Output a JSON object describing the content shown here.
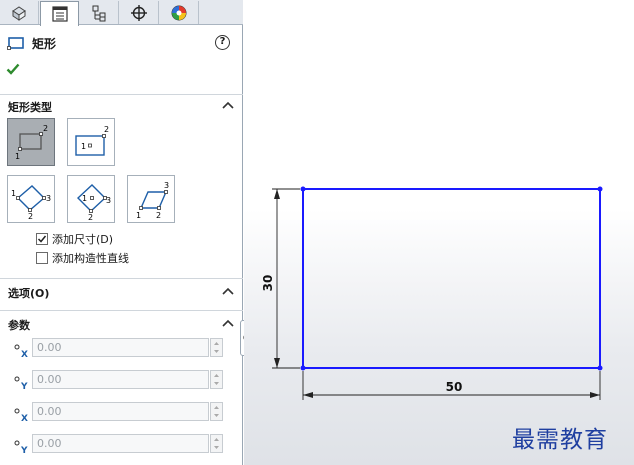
{
  "tabs": [
    {
      "name": "featuremanager-tab",
      "icon": "feature-tree-icon"
    },
    {
      "name": "propertymanager-tab",
      "icon": "property-manager-icon",
      "active": true
    },
    {
      "name": "configurationmanager-tab",
      "icon": "configuration-icon"
    },
    {
      "name": "dimxpertmanager-tab",
      "icon": "crosshair-icon"
    },
    {
      "name": "displaymanager-tab",
      "icon": "appearance-icon"
    }
  ],
  "property_manager": {
    "title": "矩形",
    "help_symbol": "?",
    "rectangle_type": {
      "title": "矩形类型",
      "options": [
        {
          "name": "corner-rectangle",
          "selected": true
        },
        {
          "name": "center-rectangle",
          "selected": false
        },
        {
          "name": "3-point-corner-rectangle",
          "selected": false
        },
        {
          "name": "3-point-center-rectangle",
          "selected": false
        },
        {
          "name": "parallelogram",
          "selected": false
        }
      ],
      "add_dimensions_label": "添加尺寸(D)",
      "add_dimensions_checked": true,
      "add_construction_label": "添加构造性直线",
      "add_construction_checked": false
    },
    "options_section": {
      "title": "选项(O)"
    },
    "parameters": {
      "title": "参数",
      "rows": [
        {
          "axis": "X",
          "value": "0.00"
        },
        {
          "axis": "Y",
          "value": "0.00"
        },
        {
          "axis": "X",
          "value": "0.00"
        },
        {
          "axis": "Y",
          "value": "0.00"
        }
      ]
    }
  },
  "sketch": {
    "width_dimension": "50",
    "height_dimension": "30",
    "line_color": "#1a1aff"
  },
  "watermark": "最需教育",
  "colors": {
    "accent": "#1a1aff",
    "ok_green": "#2e8b2e",
    "watermark": "#1f3fa0"
  }
}
